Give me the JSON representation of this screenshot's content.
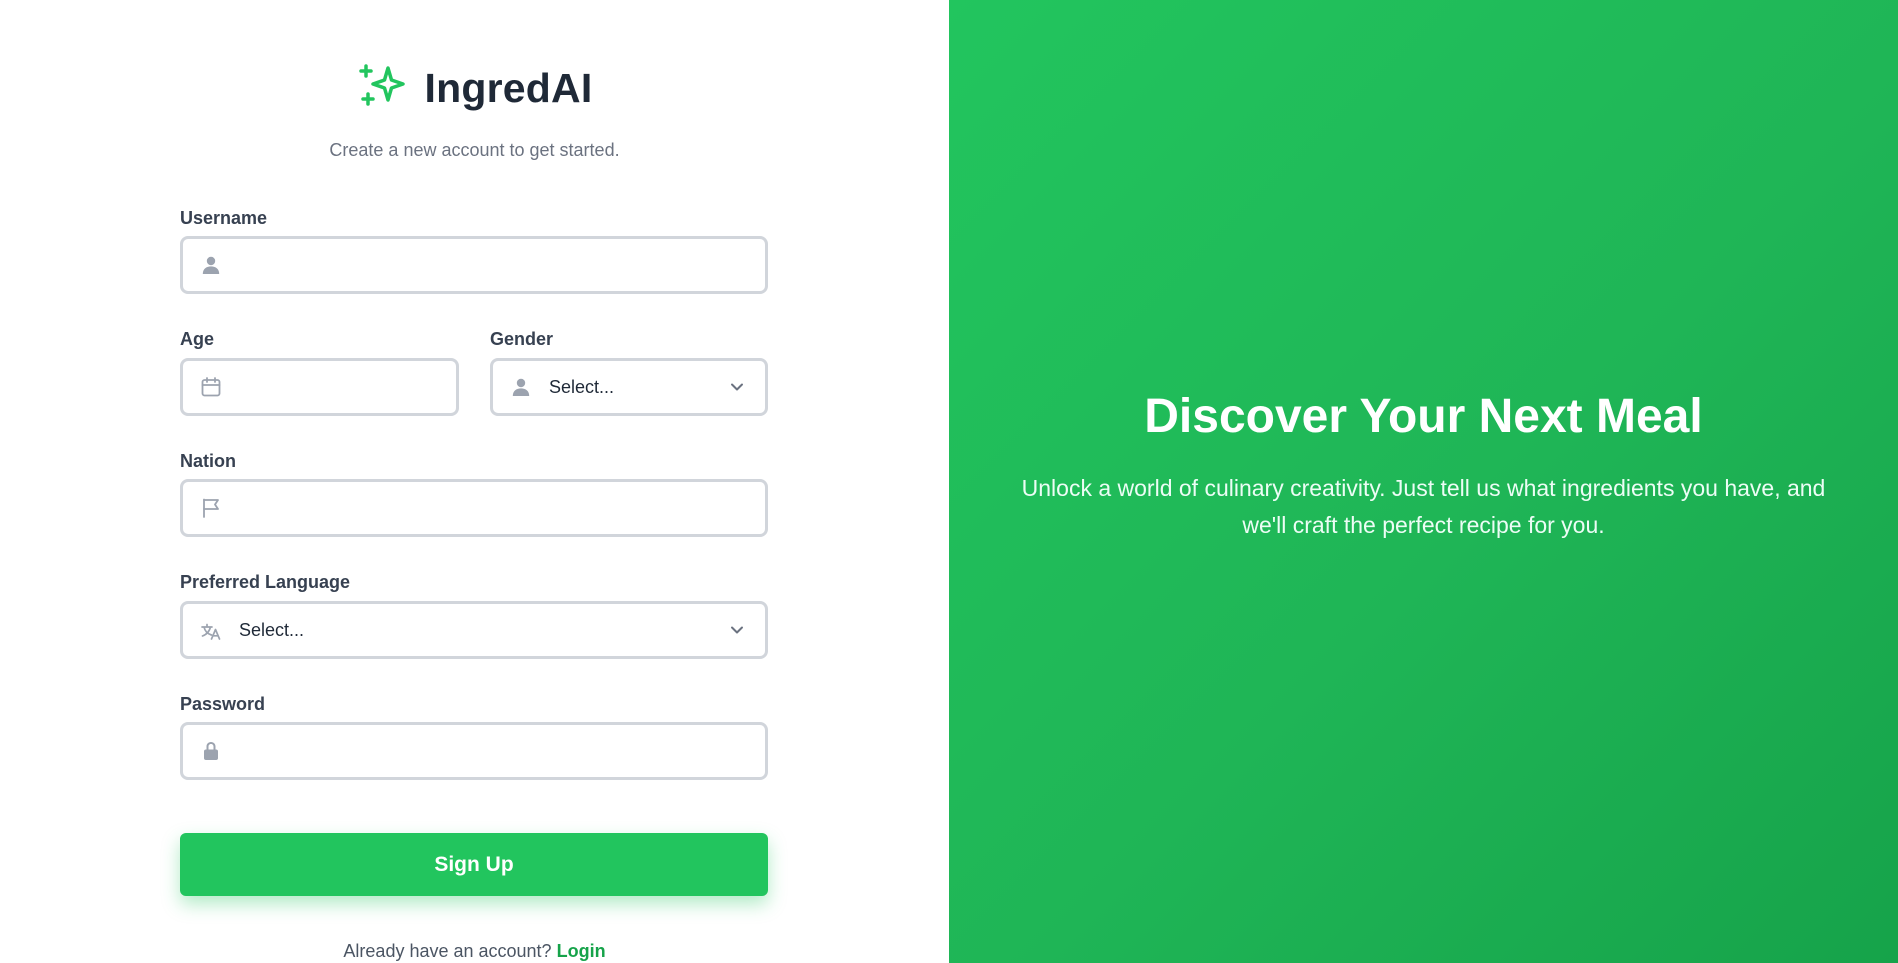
{
  "brand": {
    "name": "IngredAI",
    "subtitle": "Create a new account to get started."
  },
  "form": {
    "username": {
      "label": "Username",
      "value": "",
      "icon": "user-icon"
    },
    "age": {
      "label": "Age",
      "value": "",
      "icon": "calendar-icon"
    },
    "gender": {
      "label": "Gender",
      "selected": "Select...",
      "icon": "user-icon"
    },
    "nation": {
      "label": "Nation",
      "value": "",
      "icon": "flag-icon"
    },
    "language": {
      "label": "Preferred Language",
      "selected": "Select...",
      "icon": "translate-icon"
    },
    "password": {
      "label": "Password",
      "value": "",
      "icon": "lock-icon"
    },
    "submit_label": "Sign Up"
  },
  "footer": {
    "prompt": "Already have an account?",
    "login_label": "Login"
  },
  "hero": {
    "title": "Discover Your Next Meal",
    "text": "Unlock a world of culinary creativity. Just tell us what ingredients you have, and we'll craft the perfect recipe for you."
  },
  "colors": {
    "accent": "#22c55e",
    "accent_dark": "#16a34a",
    "border": "#d1d5db",
    "icon": "#9ca3af"
  }
}
